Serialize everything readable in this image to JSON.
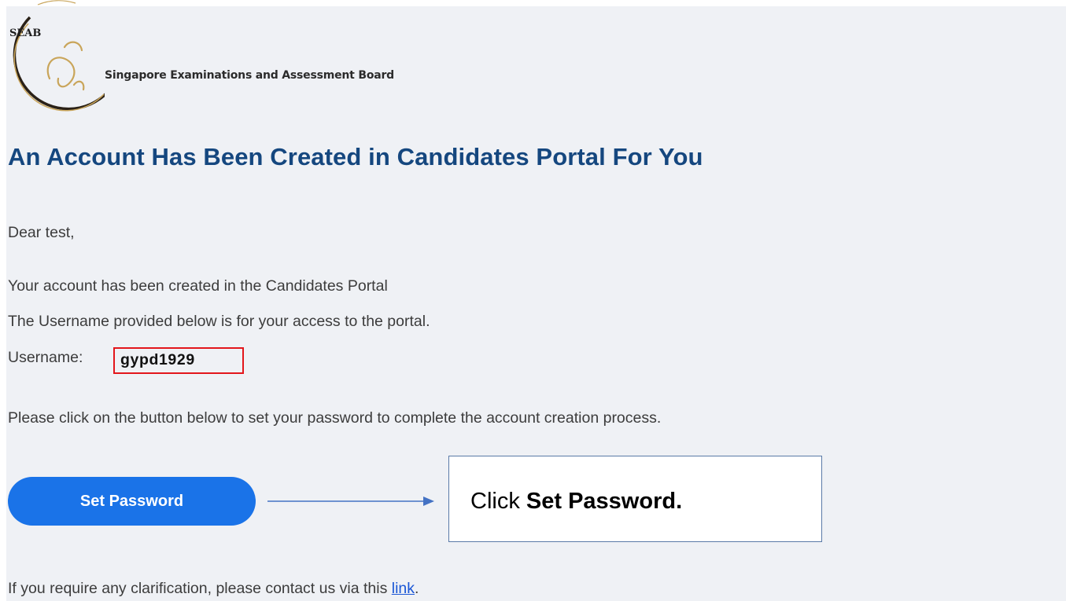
{
  "brand": {
    "logo_text": "SEAB",
    "organization_name": "Singapore Examinations and Assessment Board"
  },
  "email": {
    "heading": "An Account Has Been Created in Candidates Portal For You",
    "greeting": "Dear test,",
    "line_account_created": "Your account has been created in the Candidates Portal",
    "line_username_info": "The Username provided below is for your access to the portal.",
    "username_label": "Username",
    "username_colon": ":",
    "username_value": "gypd1929",
    "instruction": "Please click on the button below to set your password to complete the account creation process.",
    "set_password_button": "Set Password",
    "contact_prefix": "If you require any clarification, please contact us via this ",
    "contact_link": "link",
    "contact_suffix": "."
  },
  "annotation": {
    "callout_prefix": "Click ",
    "callout_bold": "Set Password.",
    "highlight_color": "#e3161b",
    "arrow_color": "#4472c4"
  },
  "colors": {
    "background": "#eff1f5",
    "heading": "#15477f",
    "button": "#1a73e8",
    "link": "#1a56d6"
  }
}
